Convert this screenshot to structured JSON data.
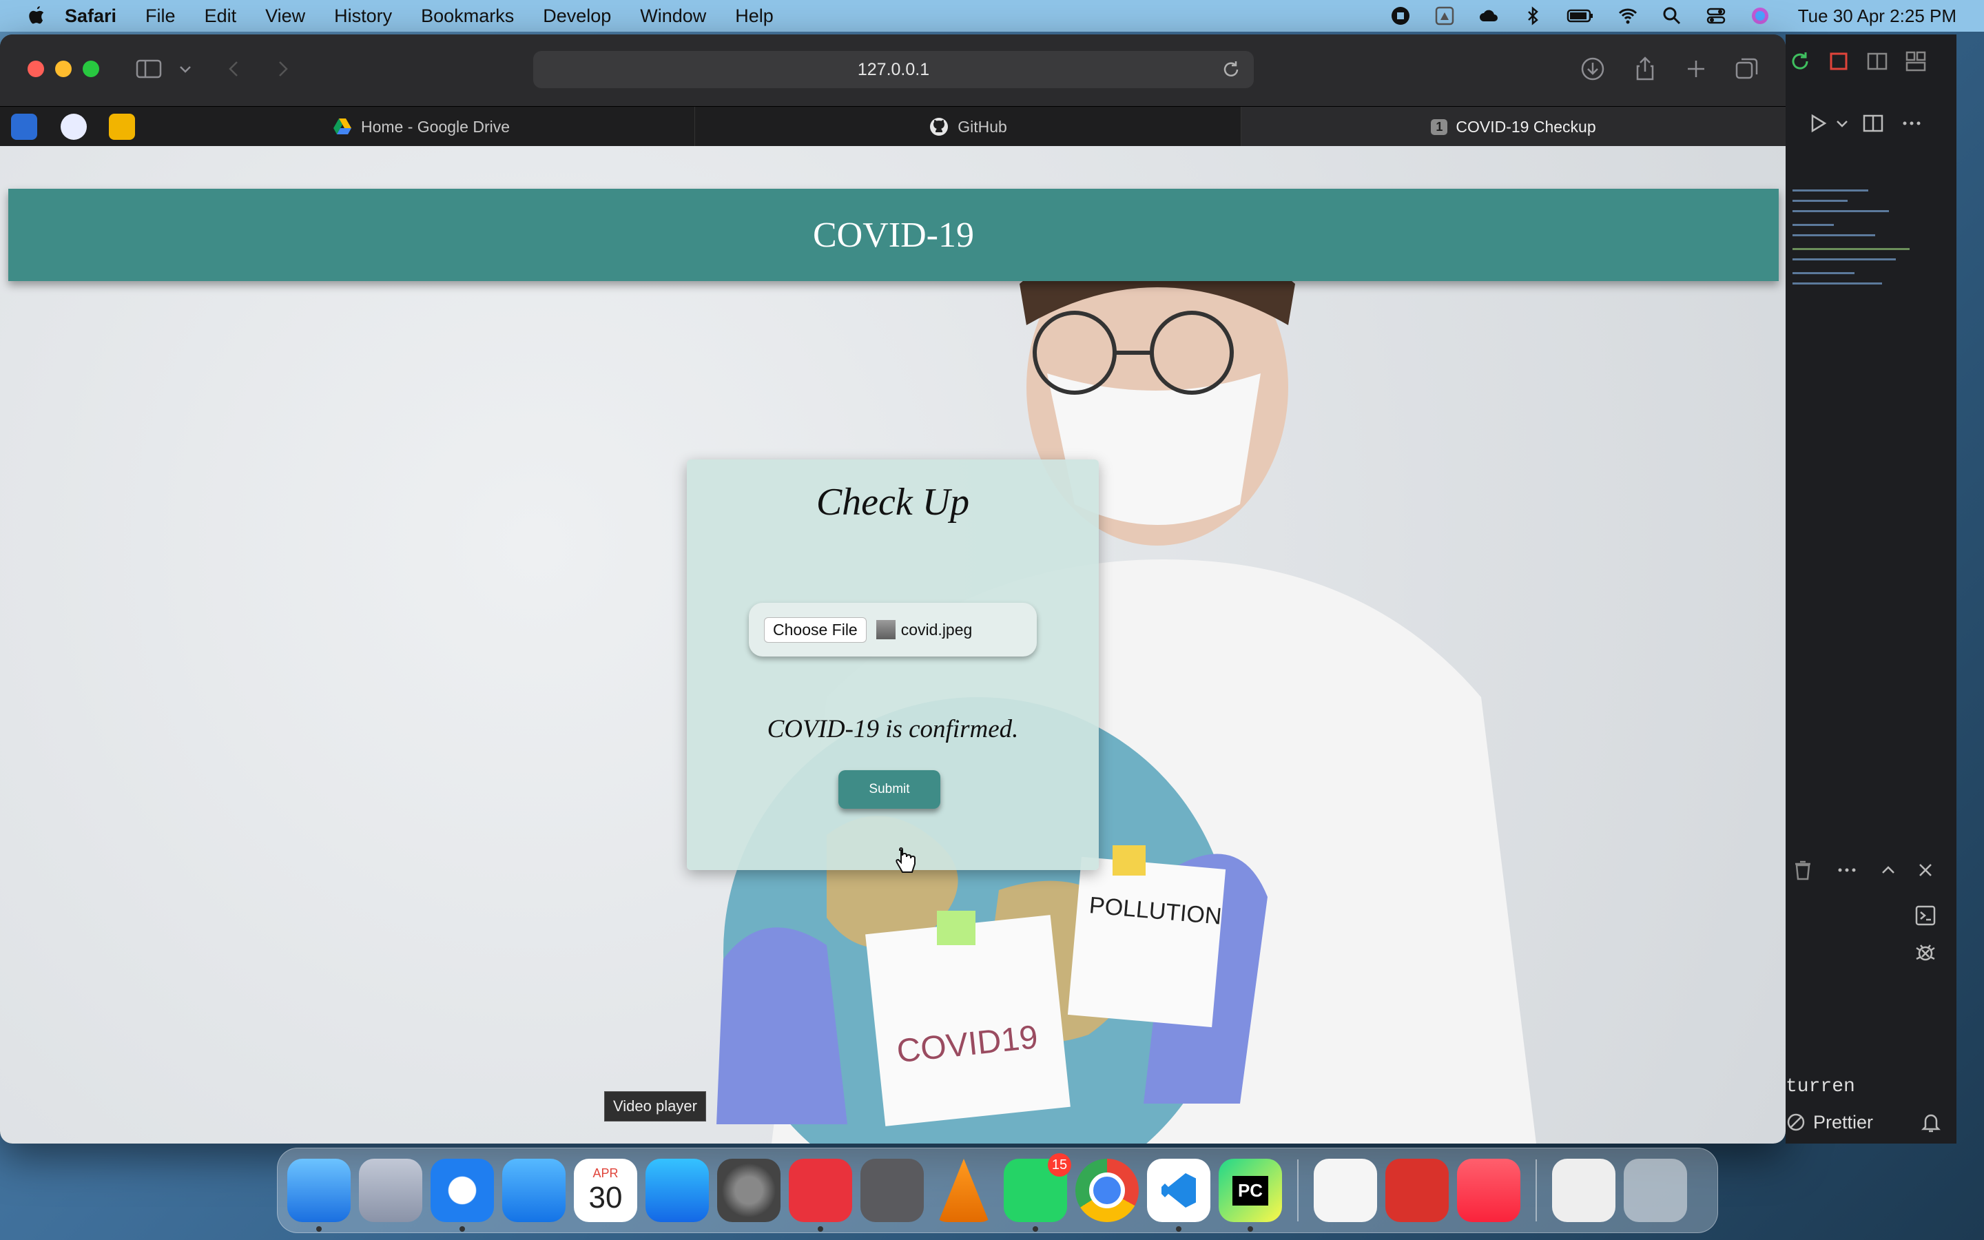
{
  "menubar": {
    "app_name": "Safari",
    "items": [
      "File",
      "Edit",
      "View",
      "History",
      "Bookmarks",
      "Develop",
      "Window",
      "Help"
    ],
    "clock": "Tue 30 Apr  2:25 PM"
  },
  "browser": {
    "address": "127.0.0.1",
    "tabs": [
      {
        "label": "Home - Google Drive"
      },
      {
        "label": "GitHub"
      },
      {
        "label": "COVID-19 Checkup",
        "count": "1"
      }
    ]
  },
  "page": {
    "header_title": "COVID-19",
    "card_title": "Check Up",
    "choose_file_label": "Choose File",
    "file_name": "covid.jpeg",
    "result_text": "COVID-19 is confirmed.",
    "submit_label": "Submit",
    "tooltip": "Video player",
    "note_covid": "COVID19",
    "note_pollution": "POLLUTION"
  },
  "editor": {
    "text_turren": "turren",
    "prettier_label": "Prettier"
  },
  "dock": {
    "calendar_month": "APR",
    "calendar_day": "30",
    "whatsapp_badge": "15",
    "pycharm_label": "PC"
  }
}
